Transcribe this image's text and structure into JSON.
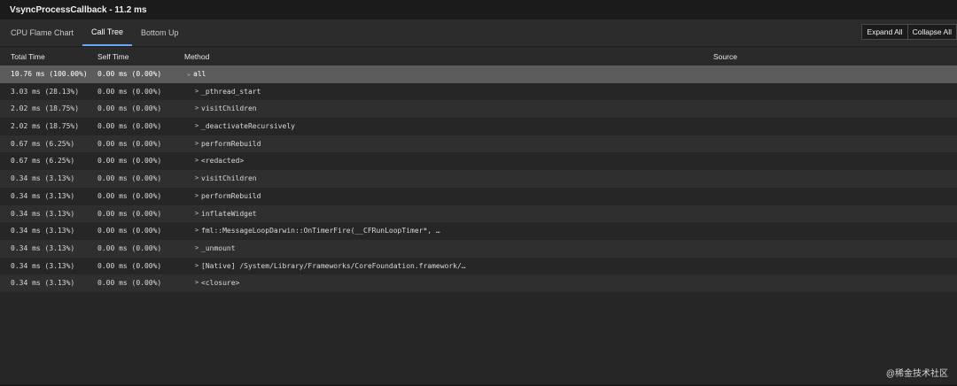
{
  "window": {
    "title": "VsyncProcessCallback - 11.2 ms"
  },
  "tabs": [
    {
      "label": "CPU Flame Chart",
      "active": false
    },
    {
      "label": "Call Tree",
      "active": true
    },
    {
      "label": "Bottom Up",
      "active": false
    }
  ],
  "actions": {
    "expand_all": "Expand All",
    "collapse_all": "Collapse All"
  },
  "columns": {
    "total_time": "Total Time",
    "self_time": "Self Time",
    "method": "Method",
    "source": "Source"
  },
  "rows": [
    {
      "total": "10.76 ms (100.00%)",
      "self": "0.00 ms (0.00%)",
      "caret": "⌄",
      "method": "all",
      "selected": true,
      "depth": 0
    },
    {
      "total": "3.03 ms (28.13%)",
      "self": "0.00 ms (0.00%)",
      "caret": ">",
      "method": "_pthread_start",
      "depth": 1
    },
    {
      "total": "2.02 ms (18.75%)",
      "self": "0.00 ms (0.00%)",
      "caret": ">",
      "method": "visitChildren",
      "depth": 1
    },
    {
      "total": "2.02 ms (18.75%)",
      "self": "0.00 ms (0.00%)",
      "caret": ">",
      "method": "_deactivateRecursively",
      "depth": 1
    },
    {
      "total": "0.67 ms (6.25%)",
      "self": "0.00 ms (0.00%)",
      "caret": ">",
      "method": "performRebuild",
      "depth": 1
    },
    {
      "total": "0.67 ms (6.25%)",
      "self": "0.00 ms (0.00%)",
      "caret": ">",
      "method": "<redacted>",
      "depth": 1
    },
    {
      "total": "0.34 ms (3.13%)",
      "self": "0.00 ms (0.00%)",
      "caret": ">",
      "method": "visitChildren",
      "depth": 1
    },
    {
      "total": "0.34 ms (3.13%)",
      "self": "0.00 ms (0.00%)",
      "caret": ">",
      "method": "performRebuild",
      "depth": 1
    },
    {
      "total": "0.34 ms (3.13%)",
      "self": "0.00 ms (0.00%)",
      "caret": ">",
      "method": "inflateWidget",
      "depth": 1
    },
    {
      "total": "0.34 ms (3.13%)",
      "self": "0.00 ms (0.00%)",
      "caret": ">",
      "method": "fml::MessageLoopDarwin::OnTimerFire(__CFRunLoopTimer*, …",
      "depth": 1
    },
    {
      "total": "0.34 ms (3.13%)",
      "self": "0.00 ms (0.00%)",
      "caret": ">",
      "method": "_unmount",
      "depth": 1
    },
    {
      "total": "0.34 ms (3.13%)",
      "self": "0.00 ms (0.00%)",
      "caret": ">",
      "method": "[Native] /System/Library/Frameworks/CoreFoundation.framework/…",
      "depth": 1
    },
    {
      "total": "0.34 ms (3.13%)",
      "self": "0.00 ms (0.00%)",
      "caret": ">",
      "method": "<closure>",
      "depth": 1
    }
  ],
  "watermark": "@稀金技术社区"
}
